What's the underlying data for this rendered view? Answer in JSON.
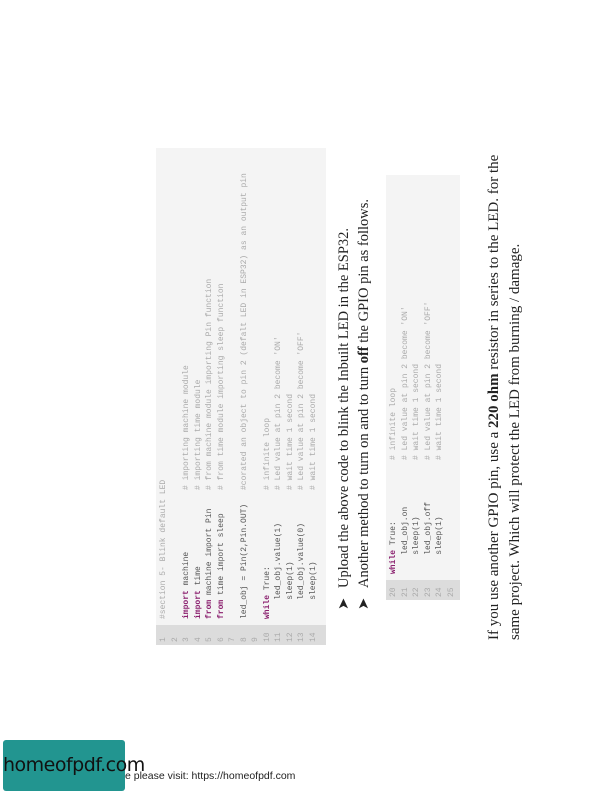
{
  "code_block_1": {
    "lines": [
      {
        "num": "1",
        "code": "#section 5- Blink default LED",
        "comment": ""
      },
      {
        "num": "2",
        "code": "",
        "comment": ""
      },
      {
        "num": "3",
        "kw": "import",
        "code": " machine",
        "comment": "# importing machine module"
      },
      {
        "num": "4",
        "kw": "import",
        "code": " time",
        "comment": "# importing time module"
      },
      {
        "num": "5",
        "kw": "from",
        "code": " machine import Pin",
        "comment": "# from machine module importing Pin function"
      },
      {
        "num": "6",
        "kw": "from",
        "code": " time import sleep",
        "comment": "# from time module importing sleep function"
      },
      {
        "num": "7",
        "code": "",
        "comment": ""
      },
      {
        "num": "8",
        "code": "led_obj = Pin(2,Pin.OUT)",
        "comment": "#corated an object to pin 2 (defalt LED in ESP32) as an output pin"
      },
      {
        "num": "9",
        "code": "",
        "comment": ""
      },
      {
        "num": "10",
        "kw": "while",
        "code": " True:",
        "comment": "# infinite loop"
      },
      {
        "num": "11",
        "code": "    led_obj.value(1)",
        "comment": "# Led value at pin 2 become 'ON'"
      },
      {
        "num": "12",
        "code": "    sleep(1)",
        "comment": "# wait time 1 second"
      },
      {
        "num": "13",
        "code": "    led_obj.value(0)",
        "comment": "# Led value at pin 2 become 'OFF'"
      },
      {
        "num": "14",
        "code": "    sleep(1)",
        "comment": "# wait time 1 second"
      }
    ]
  },
  "bullets": [
    {
      "mark": "➤",
      "text": "Upload the above code to blink the Inbuilt LED in the ESP32."
    },
    {
      "mark": "➤",
      "pre": "Another method to turn on and to turn ",
      "bold": "off",
      "post": " the GPIO pin as follows."
    }
  ],
  "code_block_2": {
    "lines": [
      {
        "num": "20",
        "kw": "while",
        "code": " True:",
        "comment": "# infinite loop"
      },
      {
        "num": "21",
        "code": "    led_obj.on",
        "comment": "# Led value at pin 2 become 'ON'"
      },
      {
        "num": "22",
        "code": "    sleep(1)",
        "comment": "# wait time 1 second"
      },
      {
        "num": "23",
        "code": "    led_obj.off",
        "comment": "# Led value at pin 2 become 'OFF'"
      },
      {
        "num": "24",
        "code": "    sleep(1)",
        "comment": "# wait time 1 second"
      },
      {
        "num": "25",
        "code": "",
        "comment": ""
      }
    ]
  },
  "paragraph": {
    "pre": "If you use another GPIO pin, use a ",
    "bold": "220 ohm",
    "post": " resistor in series to the LED. for the same project. Which will protect the LED from burning / damage."
  },
  "footer": {
    "logo": "homeofpdf.com",
    "text": "e please visit: https://homeofpdf.com"
  }
}
